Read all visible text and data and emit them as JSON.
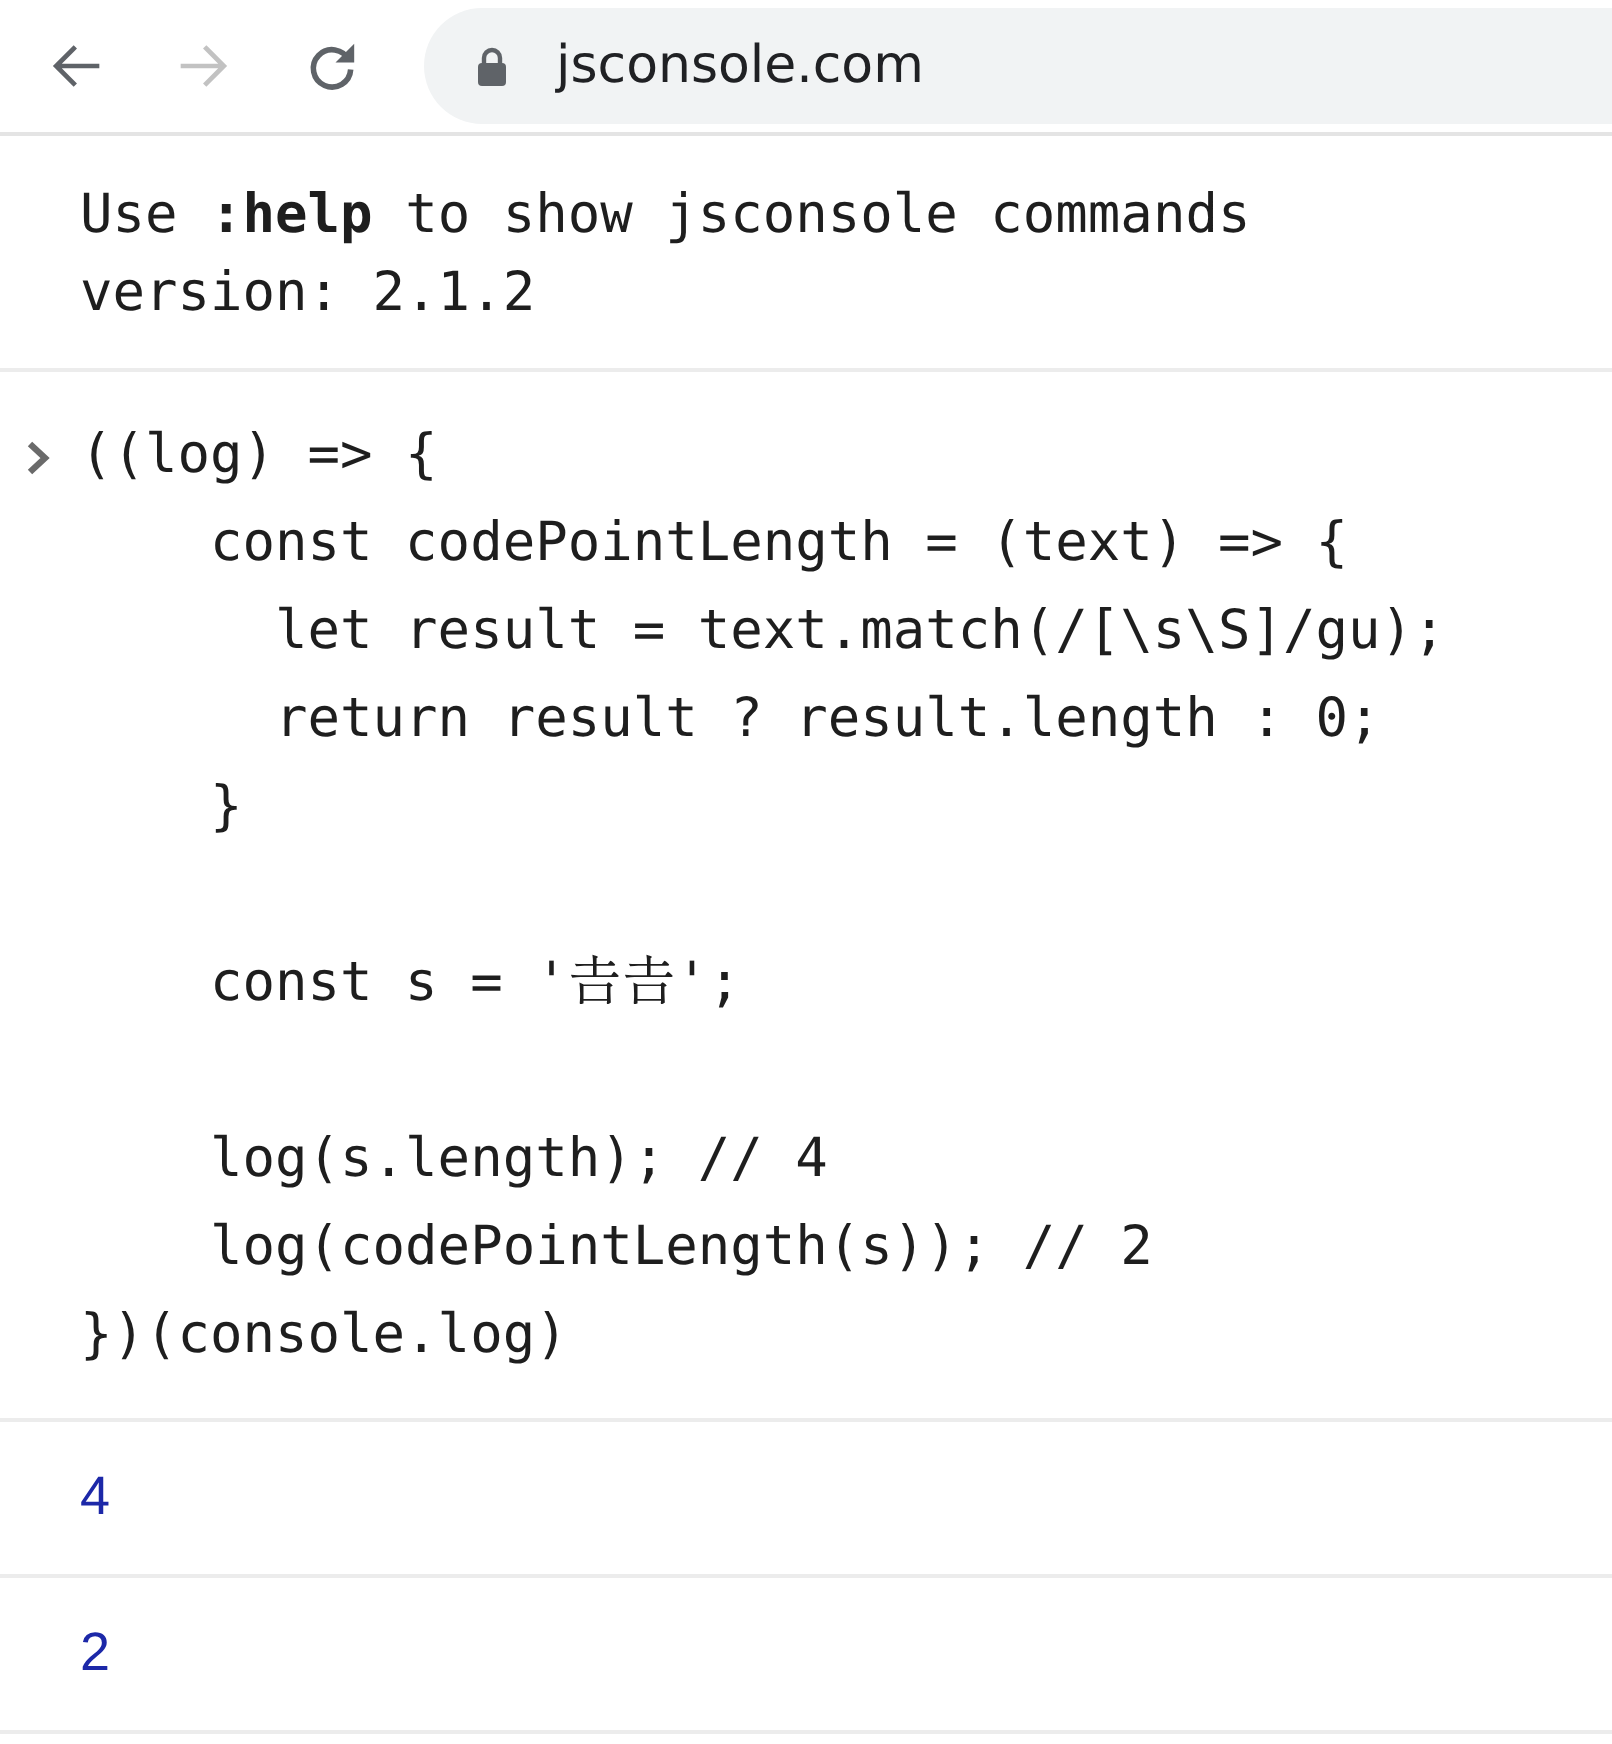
{
  "toolbar": {
    "nav_buttons": [
      {
        "kind": "back",
        "disabled": false
      },
      {
        "kind": "forward",
        "disabled": true
      },
      {
        "kind": "reload",
        "disabled": false
      }
    ],
    "address": "jsconsole.com"
  },
  "console": {
    "banner": [
      "Use **:help** to show jsconsole commands",
      "version: 2.1.2"
    ],
    "input": "((log) => {\n    const codePointLength = (text) => {\n      let result = text.match(/[\\s\\S]/gu);\n      return result ? result.length : 0;\n    }\n\n    const s = '𠮷𠮷';\n\n    log(s.length); // 4\n    log(codePointLength(s)); // 2\n})(console.log)",
    "outputs": [
      "4",
      "2"
    ]
  }
}
